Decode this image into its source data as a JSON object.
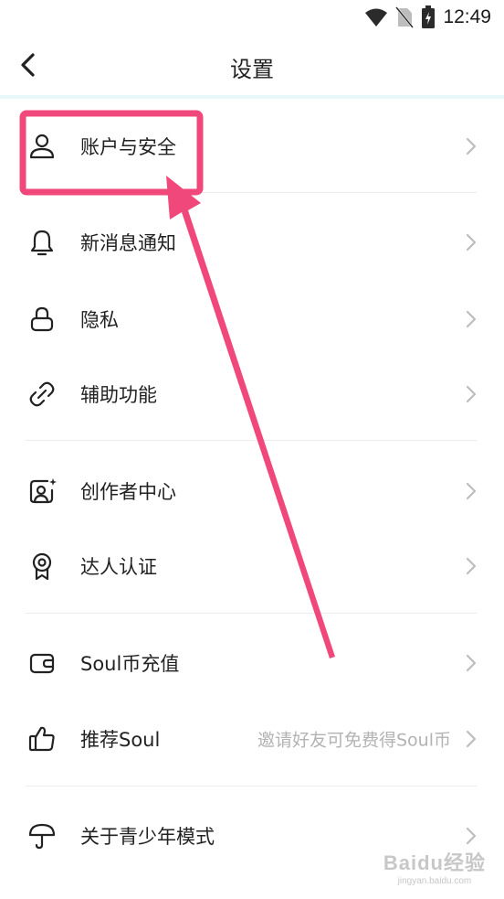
{
  "status_bar": {
    "time": "12:49",
    "icons": [
      "wifi-icon",
      "no-sim-icon",
      "battery-charging-icon"
    ]
  },
  "header": {
    "title": "设置",
    "back_icon": "back-chevron-icon"
  },
  "groups": [
    {
      "items": [
        {
          "label": "账户与安全",
          "icon": "person-icon"
        }
      ]
    },
    {
      "items": [
        {
          "label": "新消息通知",
          "icon": "bell-icon"
        },
        {
          "label": "隐私",
          "icon": "lock-icon"
        },
        {
          "label": "辅助功能",
          "icon": "link-icon"
        }
      ]
    },
    {
      "items": [
        {
          "label": "创作者中心",
          "icon": "creator-icon"
        },
        {
          "label": "达人认证",
          "icon": "badge-icon"
        }
      ]
    },
    {
      "items": [
        {
          "label": "Soul币充值",
          "icon": "wallet-icon"
        },
        {
          "label": "推荐Soul",
          "hint": "邀请好友可免费得Soul币",
          "icon": "thumbs-up-icon"
        }
      ]
    },
    {
      "items": [
        {
          "label": "关于青少年模式",
          "icon": "umbrella-icon"
        }
      ]
    }
  ],
  "annotation": {
    "color": "#f0487b",
    "target": "账户与安全"
  },
  "watermark": {
    "brand": "Baidu经验",
    "url": "jingyan.baidu.com"
  }
}
